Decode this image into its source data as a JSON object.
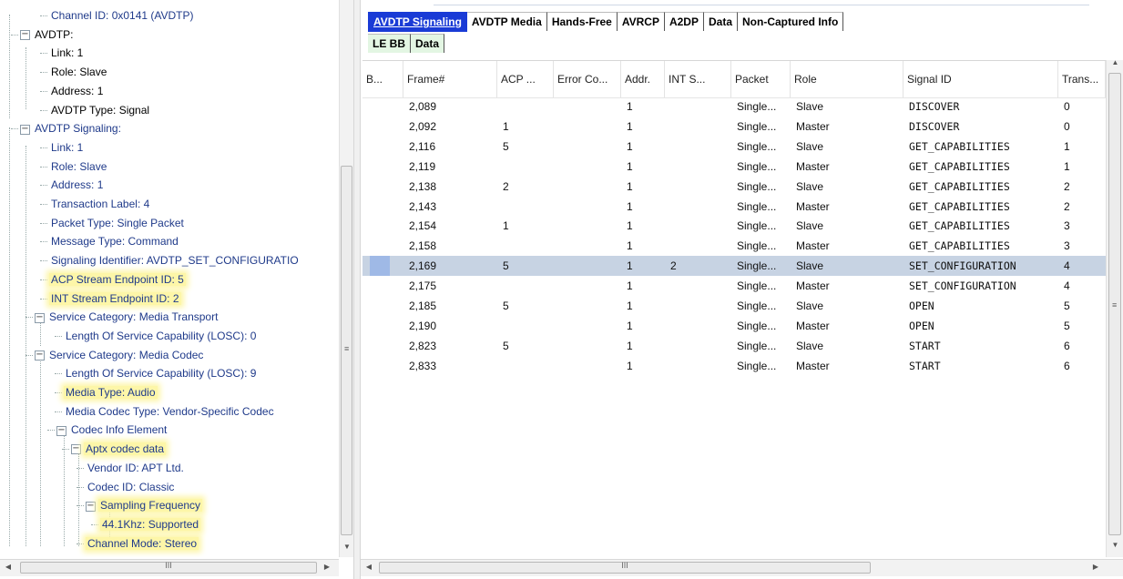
{
  "tree": {
    "rows": [
      {
        "indent": 3,
        "label": "Channel ID: 0x0141  (AVDTP)",
        "exp": "",
        "hl": false,
        "color": "blue"
      },
      {
        "indent": 1,
        "label": "AVDTP:",
        "exp": "minus",
        "hl": false,
        "color": "black"
      },
      {
        "indent": 3,
        "label": "Link: 1",
        "exp": "",
        "hl": false,
        "color": "black"
      },
      {
        "indent": 3,
        "label": "Role: Slave",
        "exp": "",
        "hl": false,
        "color": "black"
      },
      {
        "indent": 3,
        "label": "Address: 1",
        "exp": "",
        "hl": false,
        "color": "black"
      },
      {
        "indent": 3,
        "label": "AVDTP Type: Signal",
        "exp": "",
        "hl": false,
        "color": "black"
      },
      {
        "indent": 1,
        "label": "AVDTP Signaling:",
        "exp": "minus",
        "hl": false,
        "color": "blue"
      },
      {
        "indent": 3,
        "label": "Link: 1",
        "exp": "",
        "hl": false,
        "color": "blue"
      },
      {
        "indent": 3,
        "label": "Role: Slave",
        "exp": "",
        "hl": false,
        "color": "blue"
      },
      {
        "indent": 3,
        "label": "Address: 1",
        "exp": "",
        "hl": false,
        "color": "blue"
      },
      {
        "indent": 3,
        "label": "Transaction Label: 4",
        "exp": "",
        "hl": false,
        "color": "blue"
      },
      {
        "indent": 3,
        "label": "Packet Type: Single Packet",
        "exp": "",
        "hl": false,
        "color": "blue"
      },
      {
        "indent": 3,
        "label": "Message Type: Command",
        "exp": "",
        "hl": false,
        "color": "blue"
      },
      {
        "indent": 3,
        "label": "Signaling Identifier: AVDTP_SET_CONFIGURATIO",
        "exp": "",
        "hl": false,
        "color": "blue"
      },
      {
        "indent": 3,
        "label": "ACP Stream Endpoint ID: 5",
        "exp": "",
        "hl": true,
        "color": "blue"
      },
      {
        "indent": 3,
        "label": "INT Stream Endpoint ID: 2",
        "exp": "",
        "hl": true,
        "color": "blue"
      },
      {
        "indent": 2,
        "label": "Service Category: Media Transport",
        "exp": "minus",
        "hl": false,
        "color": "blue"
      },
      {
        "indent": 4,
        "label": "Length Of Service Capability (LOSC): 0",
        "exp": "",
        "hl": false,
        "color": "blue"
      },
      {
        "indent": 2,
        "label": "Service Category: Media Codec",
        "exp": "minus",
        "hl": false,
        "color": "blue"
      },
      {
        "indent": 4,
        "label": "Length Of Service Capability (LOSC): 9",
        "exp": "",
        "hl": false,
        "color": "blue"
      },
      {
        "indent": 4,
        "label": "Media Type: Audio",
        "exp": "",
        "hl": true,
        "color": "blue"
      },
      {
        "indent": 4,
        "label": "Media Codec Type: Vendor-Specific Codec",
        "exp": "",
        "hl": false,
        "color": "blue"
      },
      {
        "indent": 3.5,
        "label": "Codec Info Element",
        "exp": "minus",
        "hl": false,
        "color": "blue"
      },
      {
        "indent": 4.5,
        "label": "Aptx codec data",
        "exp": "minus",
        "hl": true,
        "color": "blue"
      },
      {
        "indent": 5.5,
        "label": "Vendor ID: APT Ltd.",
        "exp": "",
        "hl": false,
        "color": "blue"
      },
      {
        "indent": 5.5,
        "label": "Codec ID: Classic",
        "exp": "",
        "hl": false,
        "color": "blue"
      },
      {
        "indent": 5.5,
        "label": "Sampling Frequency",
        "exp": "minus",
        "hl": true,
        "color": "blue"
      },
      {
        "indent": 6.5,
        "label": "44.1Khz: Supported",
        "exp": "",
        "hl": true,
        "color": "blue"
      },
      {
        "indent": 5.5,
        "label": "Channel Mode: Stereo",
        "exp": "",
        "hl": true,
        "color": "blue"
      }
    ]
  },
  "tabs": {
    "row1": [
      {
        "label": "AVDTP Signaling",
        "active": true,
        "green": false
      },
      {
        "label": "AVDTP Media",
        "active": false,
        "green": false
      },
      {
        "label": "Hands-Free",
        "active": false,
        "green": false
      },
      {
        "label": "AVRCP",
        "active": false,
        "green": false
      },
      {
        "label": "A2DP",
        "active": false,
        "green": false
      },
      {
        "label": "Data",
        "active": false,
        "green": false
      },
      {
        "label": "Non-Captured Info",
        "active": false,
        "green": false
      }
    ],
    "row2": [
      {
        "label": "LE BB",
        "active": false,
        "green": true
      },
      {
        "label": "Data",
        "active": false,
        "green": true
      }
    ]
  },
  "grid": {
    "columns": [
      "B...",
      "Frame#",
      "ACP ...",
      "Error Co...",
      "Addr.",
      "INT S...",
      "Packet",
      "Role",
      "Signal ID",
      "Trans..."
    ],
    "selected_index": 8,
    "rows": [
      [
        "",
        "2,089",
        "",
        "",
        "1",
        "",
        "Single...",
        "Slave",
        "DISCOVER",
        "0"
      ],
      [
        "",
        "2,092",
        "1",
        "",
        "1",
        "",
        "Single...",
        "Master",
        "DISCOVER",
        "0"
      ],
      [
        "",
        "2,116",
        "5",
        "",
        "1",
        "",
        "Single...",
        "Slave",
        "GET_CAPABILITIES",
        "1"
      ],
      [
        "",
        "2,119",
        "",
        "",
        "1",
        "",
        "Single...",
        "Master",
        "GET_CAPABILITIES",
        "1"
      ],
      [
        "",
        "2,138",
        "2",
        "",
        "1",
        "",
        "Single...",
        "Slave",
        "GET_CAPABILITIES",
        "2"
      ],
      [
        "",
        "2,143",
        "",
        "",
        "1",
        "",
        "Single...",
        "Master",
        "GET_CAPABILITIES",
        "2"
      ],
      [
        "",
        "2,154",
        "1",
        "",
        "1",
        "",
        "Single...",
        "Slave",
        "GET_CAPABILITIES",
        "3"
      ],
      [
        "",
        "2,158",
        "",
        "",
        "1",
        "",
        "Single...",
        "Master",
        "GET_CAPABILITIES",
        "3"
      ],
      [
        "",
        "2,169",
        "5",
        "",
        "1",
        "2",
        "Single...",
        "Slave",
        "SET_CONFIGURATION",
        "4"
      ],
      [
        "",
        "2,175",
        "",
        "",
        "1",
        "",
        "Single...",
        "Master",
        "SET_CONFIGURATION",
        "4"
      ],
      [
        "",
        "2,185",
        "5",
        "",
        "1",
        "",
        "Single...",
        "Slave",
        "OPEN",
        "5"
      ],
      [
        "",
        "2,190",
        "",
        "",
        "1",
        "",
        "Single...",
        "Master",
        "OPEN",
        "5"
      ],
      [
        "",
        "2,823",
        "5",
        "",
        "1",
        "",
        "Single...",
        "Slave",
        "START",
        "6"
      ],
      [
        "",
        "2,833",
        "",
        "",
        "1",
        "",
        "Single...",
        "Master",
        "START",
        "6"
      ]
    ]
  },
  "colors": {
    "tree_text": "#1f3a8a",
    "highlight": "#fdf6a8",
    "active_tab": "#1a3bd6",
    "selected_row": "#c7d3e3"
  }
}
